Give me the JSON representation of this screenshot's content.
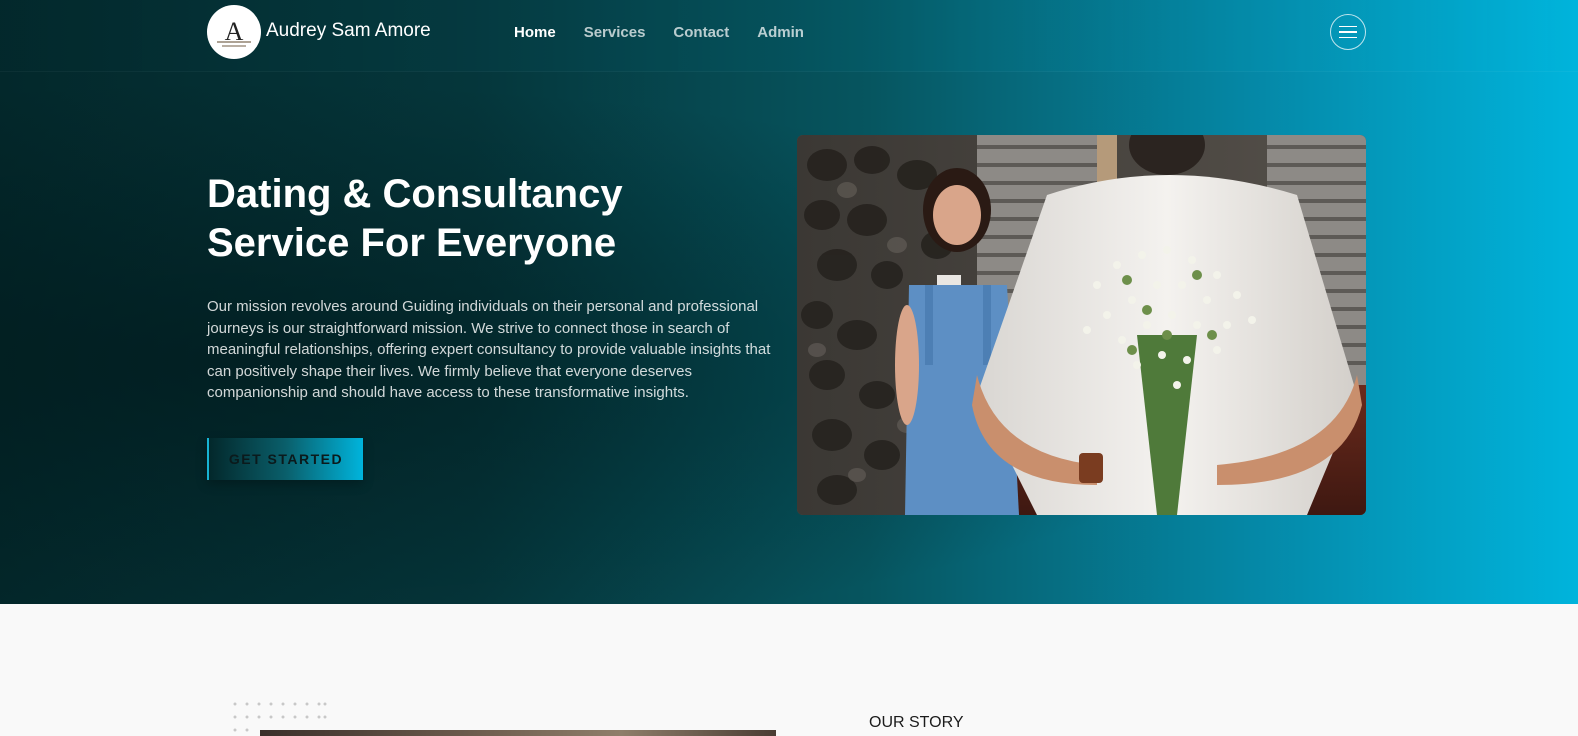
{
  "navbar": {
    "brand": "Audrey Sam Amore",
    "logo_letter": "A",
    "links": [
      {
        "label": "Home",
        "active": true
      },
      {
        "label": "Services",
        "active": false
      },
      {
        "label": "Contact",
        "active": false
      },
      {
        "label": "Admin",
        "active": false
      }
    ],
    "menu_icon": "hamburger-icon"
  },
  "hero": {
    "title_line1": "Dating & Consultancy",
    "title_line2": "Service For Everyone",
    "description": "Our mission revolves around Guiding individuals on their personal and professional journeys is our straightforward mission. We strive to connect those in search of meaningful relationships, offering expert consultancy to provide valuable insights that can positively shape their lives. We firmly believe that everyone deserves companionship and should have access to these transformative insights.",
    "cta_label": "GET STARTED"
  },
  "story": {
    "label": "OUR STORY"
  },
  "colors": {
    "hero_dark": "#03282b",
    "hero_accent": "#00b4dc",
    "section_bg": "#f9f9f9"
  }
}
